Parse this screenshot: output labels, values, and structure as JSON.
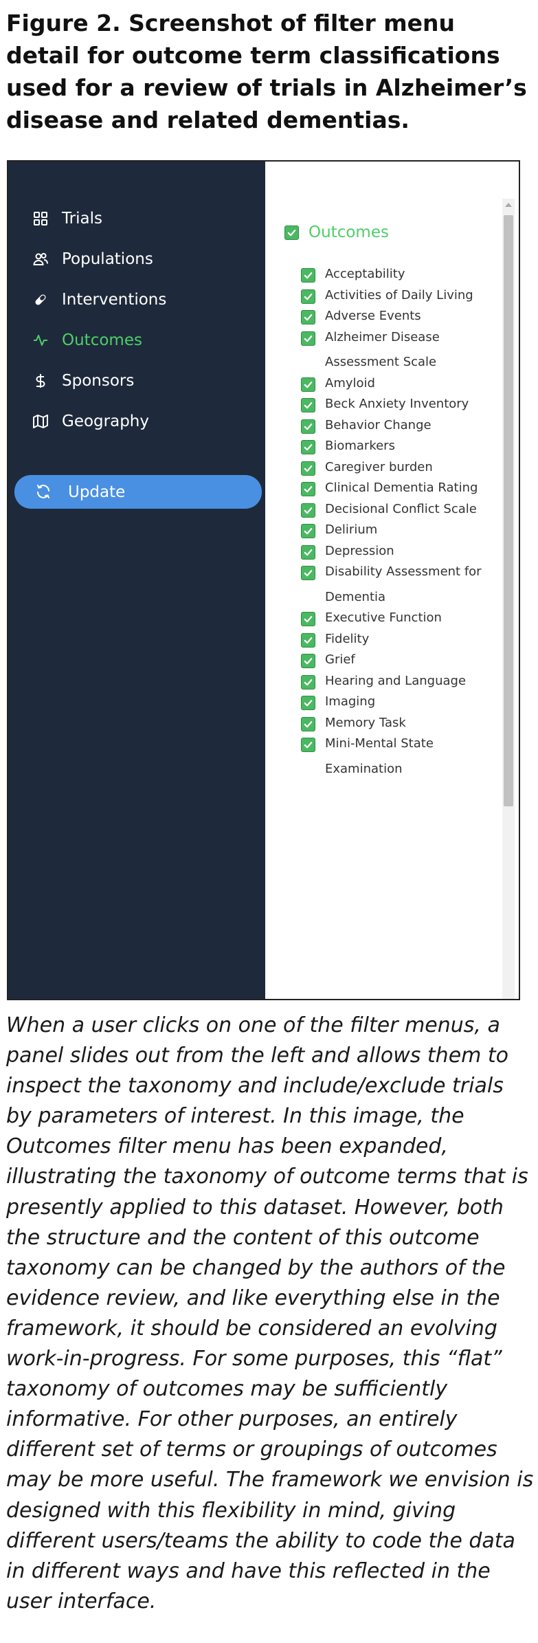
{
  "figure_title": "Figure 2. Screenshot of filter menu detail for outcome term classifications used for a review of trials in Alzheimer’s disease and related dementias.",
  "sidebar": {
    "items": [
      {
        "label": "Trials",
        "icon": "grid-icon"
      },
      {
        "label": "Populations",
        "icon": "users-icon"
      },
      {
        "label": "Interventions",
        "icon": "pill-icon"
      },
      {
        "label": "Outcomes",
        "icon": "activity-icon",
        "active": true
      },
      {
        "label": "Sponsors",
        "icon": "dollar-icon"
      },
      {
        "label": "Geography",
        "icon": "map-icon"
      }
    ],
    "update_label": "Update",
    "update_icon": "refresh-icon"
  },
  "filter_panel": {
    "header": "Outcomes",
    "items": [
      "Acceptability",
      "Activities of Daily Living",
      "Adverse Events",
      "Alzheimer Disease Assessment Scale",
      "Amyloid",
      "Beck Anxiety Inventory",
      "Behavior Change",
      "Biomarkers",
      "Caregiver burden",
      "Clinical Dementia Rating",
      "Decisional Conflict Scale",
      "Delirium",
      "Depression",
      "Disability Assessment for Dementia",
      "Executive Function",
      "Fidelity",
      "Grief",
      "Hearing and Language",
      "Imaging",
      "Memory Task",
      "Mini-Mental State Examination"
    ]
  },
  "caption": "When a user clicks on one of the filter menus, a panel slides out from the left and allows them to inspect the taxonomy and include/exclude trials by parameters of interest. In this image, the Outcomes filter menu has been expanded, illustrating the taxonomy of outcome terms that is presently applied to this dataset. However, both the structure and the content of this outcome taxonomy can be changed by the authors of the evidence review, and like everything else in the framework, it should be considered an evolving work-in-progress. For some purposes, this “flat” taxonomy of outcomes may be sufficiently informative. For other purposes, an entirely different set of terms or groupings of outcomes may be more useful. The framework we envision is designed with this flexibility in mind, giving different users/teams the ability to code the data in different ways and have this reflected in the user interface.",
  "colors": {
    "sidebar_bg": "#1e2a3b",
    "active": "#4fce68",
    "update_button": "#4a90e2",
    "checkbox": "#4bb862"
  }
}
